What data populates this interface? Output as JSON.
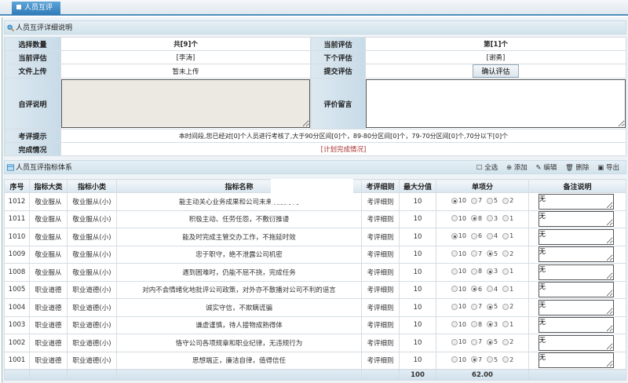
{
  "tab": {
    "label": "人员互评"
  },
  "info": {
    "title": "人员互评详细说明",
    "rows": {
      "select_count_label": "选择数量",
      "select_count": "共[9]个",
      "current_index_label": "当前评估",
      "current_index": "第[1]个",
      "current_person_label": "当前评估",
      "current_person": "[李涛]",
      "next_person_label": "下个评估",
      "next_person": "[谢勇]",
      "file_label": "文件上传",
      "file_value": "暂未上传",
      "submit_label": "提交评估",
      "submit_button": "确认评估",
      "self_comment_label": "自评说明",
      "self_comment": "",
      "review_comment_label": "评价留言",
      "review_comment": "",
      "hint_label": "考评提示",
      "hint": "本时间段,您已经对[0]个人员进行考核了,大于90分区间[0]个，89-80分区间[0]个，79-70分区间[0]个,70分以下[0]个",
      "completion_label": "完成情况",
      "completion_link": "[计划完成情况]"
    }
  },
  "indicators": {
    "title": "人员互评指标体系",
    "toolbar": {
      "select_all": "全选",
      "add": "添加",
      "edit": "编辑",
      "delete": "删除",
      "export": "导出"
    },
    "columns": [
      "序号",
      "指标大类",
      "指标小类",
      "指标名称",
      "考评细则",
      "最大分值",
      "单项分",
      "备注说明"
    ],
    "rows": [
      {
        "id": "1012",
        "major": "敬业服从",
        "minor": "敬业服从(小)",
        "name": "能主动关心业务成果和公司未来发展方向",
        "rule": "考评细则",
        "max": "10",
        "options": [
          "10",
          "7",
          "5",
          "2"
        ],
        "selected": "10",
        "note": "无"
      },
      {
        "id": "1011",
        "major": "敬业服从",
        "minor": "敬业服从(小)",
        "name": "积极主动、任劳任怨，不敷衍推诿",
        "rule": "考评细则",
        "max": "10",
        "options": [
          "10",
          "8",
          "3",
          "1"
        ],
        "selected": "8",
        "note": "无"
      },
      {
        "id": "1010",
        "major": "敬业服从",
        "minor": "敬业服从(小)",
        "name": "能及时完成主管交办工作，不拖延时效",
        "rule": "考评细则",
        "max": "10",
        "options": [
          "10",
          "6",
          "4",
          "1"
        ],
        "selected": "10",
        "note": "无"
      },
      {
        "id": "1009",
        "major": "敬业服从",
        "minor": "敬业服从(小)",
        "name": "忠于职守，绝不泄露公司机密",
        "rule": "考评细则",
        "max": "10",
        "options": [
          "10",
          "7",
          "5",
          "2"
        ],
        "selected": "5",
        "note": "无"
      },
      {
        "id": "1008",
        "major": "敬业服从",
        "minor": "敬业服从(小)",
        "name": "遇到困难时，仍能不屈不挠，完成任务",
        "rule": "考评细则",
        "max": "10",
        "options": [
          "10",
          "8",
          "3",
          "1"
        ],
        "selected": "3",
        "note": "无"
      },
      {
        "id": "1005",
        "major": "职业道德",
        "minor": "职业道德(小)",
        "name": "对内不会情绪化地批评公司政策，对外亦不散播对公司不利的谣言",
        "rule": "考评细则",
        "max": "10",
        "options": [
          "10",
          "6",
          "4",
          "1"
        ],
        "selected": "6",
        "note": "无"
      },
      {
        "id": "1004",
        "major": "职业道德",
        "minor": "职业道德(小)",
        "name": "诚实守信，不欺瞒谎骗",
        "rule": "考评细则",
        "max": "10",
        "options": [
          "10",
          "7",
          "5",
          "2"
        ],
        "selected": "5",
        "note": "无"
      },
      {
        "id": "1003",
        "major": "职业道德",
        "minor": "职业道德(小)",
        "name": "谦虚谨慎，待人接物成熟得体",
        "rule": "考评细则",
        "max": "10",
        "options": [
          "10",
          "8",
          "3",
          "1"
        ],
        "selected": "3",
        "note": "无"
      },
      {
        "id": "1002",
        "major": "职业道德",
        "minor": "职业道德(小)",
        "name": "恪守公司各项规章和职业纪律，无违规行为",
        "rule": "考评细则",
        "max": "10",
        "options": [
          "10",
          "7",
          "5",
          "2"
        ],
        "selected": "5",
        "note": "无"
      },
      {
        "id": "1001",
        "major": "职业道德",
        "minor": "职业道德(小)",
        "name": "思想端正，廉洁自律，值得信任",
        "rule": "考评细则",
        "max": "10",
        "options": [
          "10",
          "7",
          "5",
          "2"
        ],
        "selected": "7",
        "note": "无"
      }
    ],
    "footer": {
      "max_total": "100",
      "score_total": "62.00"
    }
  }
}
